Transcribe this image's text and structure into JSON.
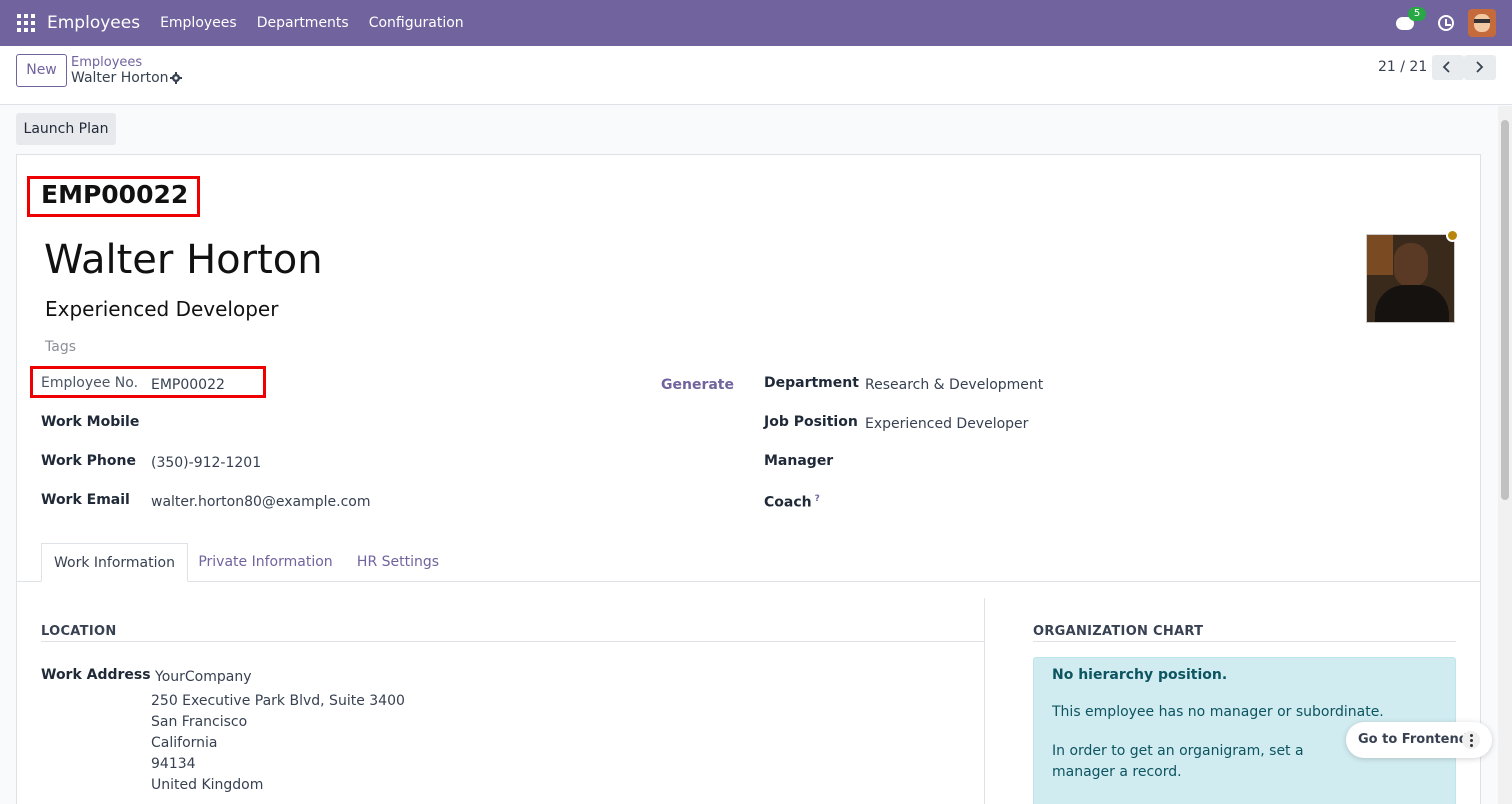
{
  "topnav": {
    "app_title": "Employees",
    "menu": [
      "Employees",
      "Departments",
      "Configuration"
    ],
    "chat_badge": "5"
  },
  "breadcrumb": {
    "parent": "Employees",
    "current": "Walter Horton"
  },
  "control": {
    "new_label": "New",
    "pager": "21 / 21"
  },
  "actions": {
    "launch_plan": "Launch Plan"
  },
  "employee": {
    "code": "EMP00022",
    "name": "Walter Horton",
    "job_title": "Experienced Developer",
    "tags_placeholder": "Tags",
    "fields_left": [
      {
        "label": "Employee No.",
        "value": "EMP00022"
      },
      {
        "label": "Work Mobile",
        "value": ""
      },
      {
        "label": "Work Phone",
        "value": "(350)-912-1201"
      },
      {
        "label": "Work Email",
        "value": "walter.horton80@example.com"
      }
    ],
    "generate_label": "Generate",
    "fields_right": [
      {
        "label": "Department",
        "value": "Research & Development"
      },
      {
        "label": "Job Position",
        "value": "Experienced Developer"
      },
      {
        "label": "Manager",
        "value": ""
      },
      {
        "label": "Coach",
        "value": "",
        "help": "?"
      }
    ]
  },
  "tabs": [
    "Work Information",
    "Private Information",
    "HR Settings"
  ],
  "work_info": {
    "location_title": "LOCATION",
    "work_address_label": "Work Address",
    "address": [
      "YourCompany",
      "250 Executive Park Blvd, Suite 3400",
      "San Francisco",
      "California",
      "94134",
      "United Kingdom"
    ]
  },
  "org_chart": {
    "title": "ORGANIZATION CHART",
    "strong": "No hierarchy position.",
    "p1": "This employee has no manager or subordinate.",
    "p2": "In order to get an organigram, set a manager a record."
  },
  "frontend": {
    "label": "Go to Frontend"
  },
  "colors": {
    "brand": "#71639e",
    "highlight_box": "#e00000",
    "info_bg": "#d1ecf1",
    "status_dot": "#b8860b"
  }
}
